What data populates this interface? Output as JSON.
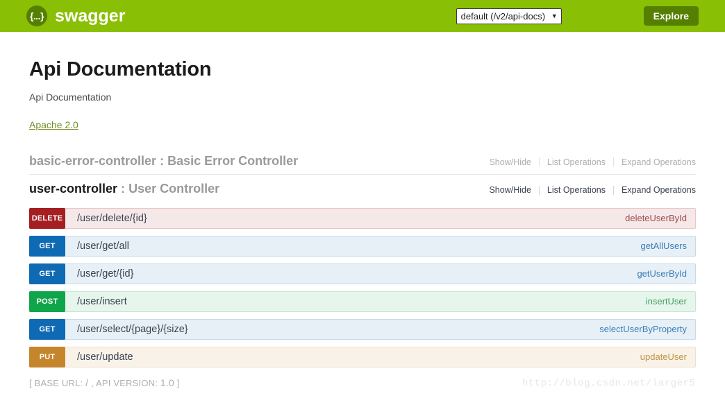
{
  "header": {
    "brand_name": "swagger",
    "logo_glyph": "{...}",
    "api_select_value": "default (/v2/api-docs)",
    "api_select_arrow": "▼",
    "explore_label": "Explore"
  },
  "info": {
    "title": "Api Documentation",
    "description": "Api Documentation",
    "license": "Apache 2.0"
  },
  "options_labels": {
    "show_hide": "Show/Hide",
    "list_operations": "List Operations",
    "expand_operations": "Expand Operations"
  },
  "resources": [
    {
      "name": "basic-error-controller",
      "separator": ":",
      "description": "Basic Error Controller",
      "muted": true,
      "operations": []
    },
    {
      "name": "user-controller",
      "separator": ":",
      "description": "User Controller",
      "muted": false,
      "operations": [
        {
          "method": "DELETE",
          "path": "/user/delete/{id}",
          "nickname": "deleteUserById"
        },
        {
          "method": "GET",
          "path": "/user/get/all",
          "nickname": "getAllUsers"
        },
        {
          "method": "GET",
          "path": "/user/get/{id}",
          "nickname": "getUserById"
        },
        {
          "method": "POST",
          "path": "/user/insert",
          "nickname": "insertUser"
        },
        {
          "method": "GET",
          "path": "/user/select/{page}/{size}",
          "nickname": "selectUserByProperty"
        },
        {
          "method": "PUT",
          "path": "/user/update",
          "nickname": "updateUser"
        }
      ]
    }
  ],
  "footer": {
    "open_bracket": "[",
    "base_url_label": "BASE URL:",
    "base_url_value": "/",
    "comma": ",",
    "api_version_label": "API VERSION:",
    "api_version_value": "1.0",
    "close_bracket": "]"
  },
  "watermark": "http://blog.csdn.net/larger5",
  "colors": {
    "header_green": "#89bf04",
    "button_green": "#547f00",
    "get": "#0f6ab4",
    "post": "#10a54a",
    "put": "#c5862b",
    "delete": "#a41e22"
  }
}
